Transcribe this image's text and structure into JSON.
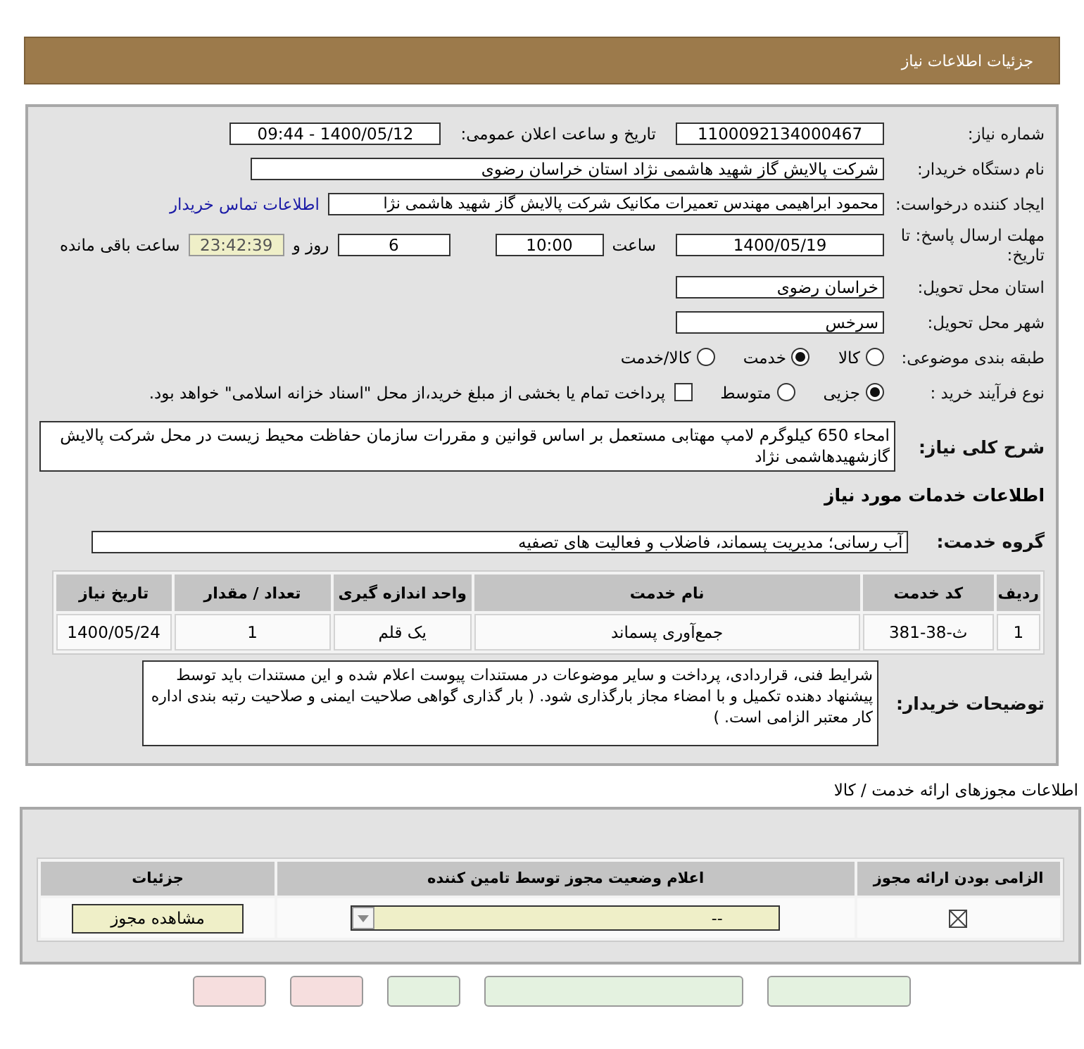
{
  "header": {
    "title": "جزئیات اطلاعات نیاز"
  },
  "details": {
    "need_number": {
      "label": "شماره نیاز:",
      "value": "1100092134000467"
    },
    "announce": {
      "label": "تاریخ و ساعت اعلان عمومی:",
      "value": "1400/05/12 - 09:44"
    },
    "buyer": {
      "label": "نام دستگاه خریدار:",
      "value": "شرکت پالایش گاز شهید هاشمی نژاد   استان خراسان رضوی"
    },
    "requester": {
      "label": "ایجاد کننده درخواست:",
      "value": "محمود ابراهیمی مهندس تعمیرات مکانیک شرکت پالایش گاز شهید هاشمی نژا",
      "link": "اطلاعات تماس خریدار"
    },
    "deadline": {
      "label": "مهلت ارسال پاسخ: تا تاریخ:",
      "date": "1400/05/19",
      "time_label": "ساعت",
      "time": "10:00",
      "days": "6",
      "days_label": "روز و",
      "remaining": "23:42:39",
      "remaining_label": "ساعت باقی مانده"
    },
    "province": {
      "label": "استان محل تحویل:",
      "value": "خراسان رضوی"
    },
    "city": {
      "label": "شهر محل تحویل:",
      "value": "سرخس"
    },
    "category": {
      "label": "طبقه بندی موضوعی:",
      "options": [
        {
          "label": "کالا",
          "selected": false
        },
        {
          "label": "خدمت",
          "selected": true
        },
        {
          "label": "کالا/خدمت",
          "selected": false
        }
      ]
    },
    "purchase": {
      "label": "نوع فرآیند خرید :",
      "options": [
        {
          "label": "جزیی",
          "selected": true
        },
        {
          "label": "متوسط",
          "selected": false
        }
      ],
      "payment": {
        "label": "پرداخت تمام یا بخشی از مبلغ خرید،از محل \"اسناد خزانه اسلامی\" خواهد بود.",
        "checked": false
      }
    },
    "description": {
      "label": "شرح کلی نیاز:",
      "value": "امحاء 650 کیلوگرم لامپ مهتابی مستعمل بر اساس قوانین و مقررات سازمان حفاظت محیط زیست در محل شرکت پالایش گازشهیدهاشمی نژاد"
    },
    "services_title": "اطلاعات خدمات مورد نیاز",
    "service_group": {
      "label": "گروه خدمت:",
      "value": "آب رسانی؛ مدیریت پسماند، فاضلاب و فعالیت های تصفیه"
    },
    "table": {
      "columns": [
        "ردیف",
        "کد خدمت",
        "نام خدمت",
        "واحد اندازه گیری",
        "تعداد / مقدار",
        "تاریخ نیاز"
      ],
      "rows": [
        [
          "1",
          "ث-38-381",
          "جمع‌آوری پسماند",
          "یک قلم",
          "1",
          "1400/05/24"
        ]
      ]
    },
    "notes": {
      "label": "توضیحات خریدار:",
      "value": "شرایط فنی، قراردادی، پرداخت و سایر موضوعات در مستندات پیوست اعلام شده و این مستندات باید توسط پیشنهاد دهنده تکمیل و با امضاء مجاز بارگذاری شود. ( بار گذاری گواهی صلاحیت ایمنی و صلاحیت رتبه بندی اداره کار معتبر الزامی است. )"
    }
  },
  "licenses": {
    "title": "اطلاعات مجوزهای ارائه خدمت / کالا",
    "columns": [
      "الزامی بودن ارائه مجوز",
      "اعلام وضعیت مجوز توسط تامین کننده",
      "جزئیات"
    ],
    "rows": [
      {
        "required": true,
        "status": "--",
        "button": "مشاهده مجوز"
      }
    ]
  }
}
